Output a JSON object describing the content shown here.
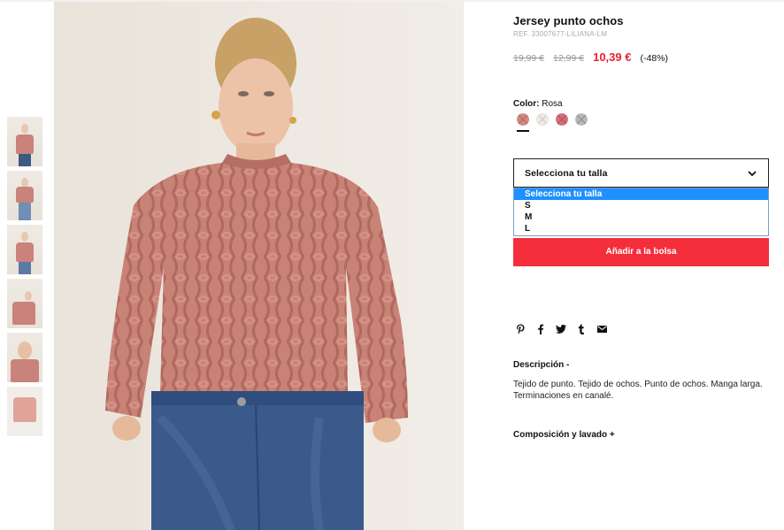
{
  "product": {
    "title": "Jersey punto ochos",
    "ref": "REF. 33007677-LILIANA-LM",
    "price_original": "19,99 €",
    "price_previous": "12,99 €",
    "price_current": "10,39 €",
    "discount": "(-48%)"
  },
  "color": {
    "label": "Color:",
    "selected": "Rosa",
    "swatches": [
      "rosa",
      "crudo",
      "rosa-oscuro",
      "gris"
    ]
  },
  "size_select": {
    "selected": "Selecciona tu talla",
    "options": [
      "Selecciona tu talla",
      "S",
      "M",
      "L"
    ]
  },
  "add_to_bag": "Añadir a la bolsa",
  "social": [
    "pinterest-icon",
    "facebook-icon",
    "twitter-icon",
    "tumblr-icon",
    "email-icon"
  ],
  "description": {
    "heading": "Descripción -",
    "text": "Tejido de punto. Tejido de ochos. Punto de ochos. Manga larga. Terminaciones en canalé."
  },
  "composition": {
    "heading": "Composición y lavado +"
  },
  "colors": {
    "accent_red": "#f42e3a",
    "price_red": "#e8232f",
    "option_highlight": "#1e90ff"
  }
}
